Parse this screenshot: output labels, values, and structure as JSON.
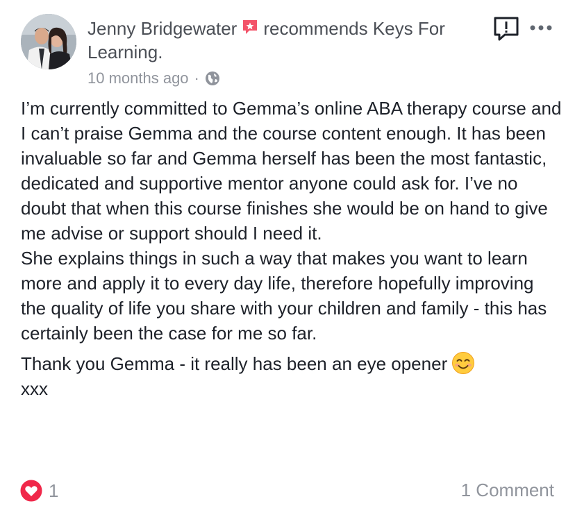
{
  "post": {
    "author": "Jenny Bridgewater",
    "action_text": "recommends Keys For Learning.",
    "timestamp": "10 months ago",
    "separator": "·",
    "body_paragraphs": [
      "I’m currently committed to Gemma’s online ABA therapy course and I can’t praise Gemma and the course content enough. It has been invaluable so far and Gemma herself has been the most fantastic, dedicated and supportive mentor anyone could ask for. I’ve no doubt that when this course finishes she would be on hand to give me advise or support should I need it.",
      "She explains things in such a way that makes you want to learn more and apply it to every day life, therefore hopefully improving the quality of life you share with your children and family - this has certainly been the case for me so far.",
      "Thank you Gemma - it really has been an eye opener"
    ],
    "sign_off": "xxx",
    "reaction_count": "1",
    "comment_count_label": "1 Comment"
  },
  "icons": {
    "recommend": "recommend-flag-icon",
    "privacy": "globe-icon",
    "report": "report-icon",
    "more": "more-options-icon",
    "emoji": "smiling-face-emoji",
    "reaction": "love-reaction-icon"
  },
  "colors": {
    "recommend_red": "#f35369",
    "text_primary": "#1d2129",
    "text_secondary": "#90949c",
    "love_red": "#f0284a"
  }
}
